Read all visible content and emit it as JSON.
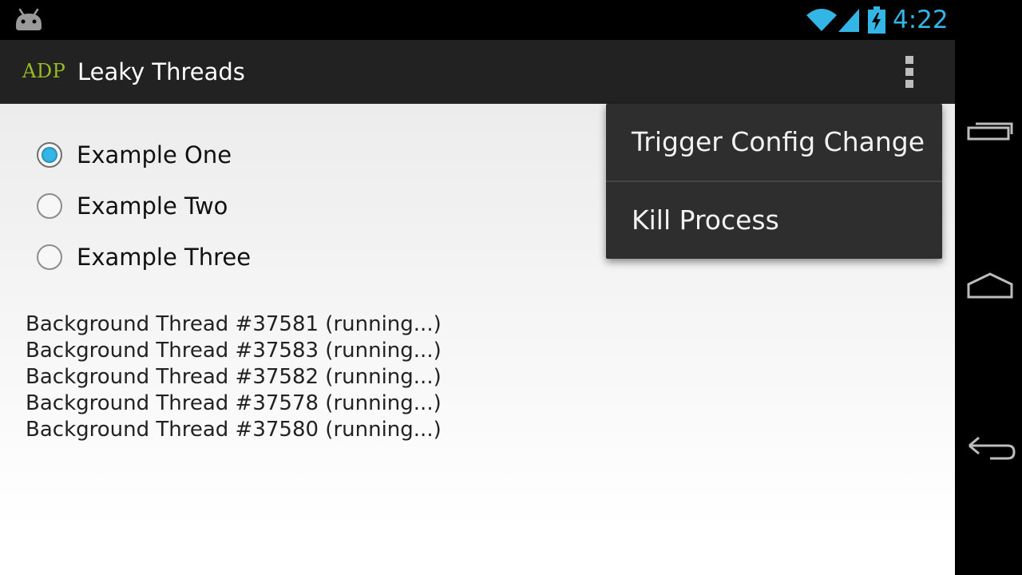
{
  "status_bar": {
    "time": "4:22",
    "icons": [
      "android-icon",
      "wifi-icon",
      "cell-signal-icon",
      "battery-charging-icon"
    ],
    "accent_color": "#33b5e5"
  },
  "action_bar": {
    "logo_text": "ADP",
    "title": "Leaky Threads",
    "overflow_icon": "overflow-menu-icon"
  },
  "radio_group": {
    "options": [
      {
        "label": "Example One",
        "checked": true
      },
      {
        "label": "Example Two",
        "checked": false
      },
      {
        "label": "Example Three",
        "checked": false
      }
    ]
  },
  "threads": [
    "Background Thread #37581 (running...)",
    "Background Thread #37583 (running...)",
    "Background Thread #37582 (running...)",
    "Background Thread #37578 (running...)",
    "Background Thread #37580 (running...)"
  ],
  "overflow_menu": {
    "items": [
      {
        "label": "Trigger Config Change"
      },
      {
        "label": "Kill Process"
      }
    ]
  },
  "nav_bar": {
    "buttons": [
      "recent-apps-icon",
      "home-icon",
      "back-icon"
    ]
  },
  "colors": {
    "action_bar_bg": "#222222",
    "logo_green": "#99bb22",
    "radio_checked": "#33b5e5",
    "menu_bg": "#2e2e2e"
  }
}
